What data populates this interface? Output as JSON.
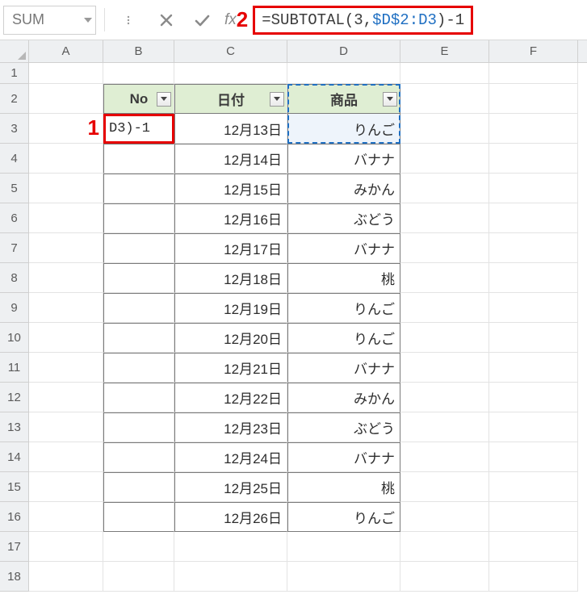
{
  "name_box": "SUM",
  "formula": {
    "prefix": "=",
    "fn": "SUBTOTAL",
    "open": "(",
    "arg1": "3",
    "comma": ",",
    "ref": "$D$2:D3",
    "close": ")",
    "suffix": "-1"
  },
  "callouts": {
    "one": "1",
    "two": "2"
  },
  "columns": [
    "A",
    "B",
    "C",
    "D",
    "E",
    "F"
  ],
  "row_numbers": [
    "1",
    "2",
    "3",
    "4",
    "5",
    "6",
    "7",
    "8",
    "9",
    "10",
    "11",
    "12",
    "13",
    "14",
    "15",
    "16",
    "17",
    "18"
  ],
  "headers": {
    "no": "No",
    "date": "日付",
    "item": "商品"
  },
  "editing_cell_display": "D3)-1",
  "rows": [
    {
      "date": "12月13日",
      "item": "りんご"
    },
    {
      "date": "12月14日",
      "item": "バナナ"
    },
    {
      "date": "12月15日",
      "item": "みかん"
    },
    {
      "date": "12月16日",
      "item": "ぶどう"
    },
    {
      "date": "12月17日",
      "item": "バナナ"
    },
    {
      "date": "12月18日",
      "item": "桃"
    },
    {
      "date": "12月19日",
      "item": "りんご"
    },
    {
      "date": "12月20日",
      "item": "りんご"
    },
    {
      "date": "12月21日",
      "item": "バナナ"
    },
    {
      "date": "12月22日",
      "item": "みかん"
    },
    {
      "date": "12月23日",
      "item": "ぶどう"
    },
    {
      "date": "12月24日",
      "item": "バナナ"
    },
    {
      "date": "12月25日",
      "item": "桃"
    },
    {
      "date": "12月26日",
      "item": "りんご"
    }
  ]
}
